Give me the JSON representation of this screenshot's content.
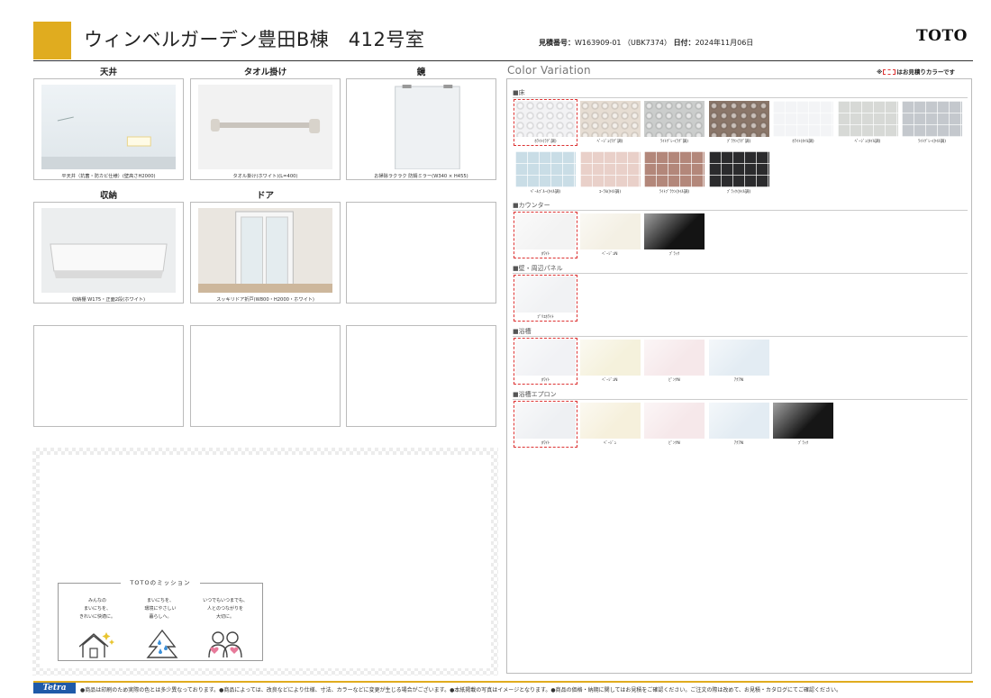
{
  "header": {
    "title": "ウィンベルガーデン豊田B棟　412号室",
    "estimate_label": "見積番号：",
    "estimate_no": "W163909-01 （UBK7374）",
    "date_label": "日付：",
    "date": "2024年11月06日",
    "logo": "TOTO",
    "accent_color": "#e0ac1f"
  },
  "products": [
    {
      "label": "天井",
      "caption": "平天井（抗菌・防カビ仕様）(壁高さH2000)",
      "image": "ceiling-panel-image"
    },
    {
      "label": "タオル掛け",
      "caption": "タオル掛け(ホワイト)(L=400)",
      "image": "towel-bar-image"
    },
    {
      "label": "鏡",
      "caption": "お掃除ラクラク 防錆ミラー(W340 × H455)",
      "image": "mirror-image"
    },
    {
      "label": "収納",
      "caption": "収納棚 W175・正面2段(ホワイト)",
      "image": "shelf-image"
    },
    {
      "label": "ドア",
      "caption": "スッキリドア折戸(W800・H2000・ホワイト)",
      "image": "door-image"
    },
    {
      "label": "",
      "caption": "",
      "image": ""
    },
    {
      "label": "",
      "caption": "",
      "image": ""
    },
    {
      "label": "",
      "caption": "",
      "image": ""
    },
    {
      "label": "",
      "caption": "",
      "image": ""
    }
  ],
  "mission": {
    "title": "TOTOのミッション",
    "columns": [
      {
        "lines": [
          "みんなの",
          "まいにちを、",
          "きれいに快適に。"
        ],
        "icon": "house-sparkle-icon"
      },
      {
        "lines": [
          "まいにちを、",
          "環境にやさしい",
          "暮らしへ。"
        ],
        "icon": "tree-water-icon"
      },
      {
        "lines": [
          "いつでもいつまでも、",
          "人とのつながりを",
          "大切に。"
        ],
        "icon": "people-heart-icon"
      }
    ]
  },
  "color_variation": {
    "title": "Color Variation",
    "note_prefix": "※",
    "note_suffix": "はお見積りカラーです",
    "sections": [
      {
        "name": "■床",
        "swatches": [
          {
            "label": "ﾎﾜｲﾄ(ﾗｸﾞ調)",
            "color": "#f2f2f4",
            "pattern": "tile",
            "selected": true
          },
          {
            "label": "ﾍﾞｰｼﾞｭ(ﾗｸﾞ調)",
            "color": "#e6ddd3",
            "pattern": "tile",
            "selected": false
          },
          {
            "label": "ﾗｲﾄｸﾞﾚｰ(ﾗｸﾞ調)",
            "color": "#cbcdcc",
            "pattern": "tile",
            "selected": false
          },
          {
            "label": "ﾌﾞﾗｳﾝ(ﾗｸﾞ調)",
            "color": "#8a7669",
            "pattern": "tile",
            "selected": false
          },
          {
            "label": "ﾎﾜｲﾄ(ﾀｲﾙ調)",
            "color": "#f3f4f6",
            "pattern": "grid",
            "selected": false
          },
          {
            "label": "ﾍﾞｰｼﾞｭ(ﾀｲﾙ調)",
            "color": "#d7d9d6",
            "pattern": "grid",
            "selected": false
          },
          {
            "label": "ﾗｲﾄｸﾞﾚｰ(ﾀｲﾙ調)",
            "color": "#c4c8cd",
            "pattern": "grid",
            "selected": false
          },
          {
            "label": "ﾍﾟｰﾙﾌﾞﾙｰ(ﾀｲﾙ調)",
            "color": "#c9dde6",
            "pattern": "grid",
            "selected": false
          },
          {
            "label": "ｺｰﾗﾙ(ﾀｲﾙ調)",
            "color": "#e9d0c9",
            "pattern": "grid",
            "selected": false
          },
          {
            "label": "ﾗｲﾄﾌﾞﾗｳﾝ(ﾀｲﾙ調)",
            "color": "#b3877a",
            "pattern": "grid",
            "selected": false
          },
          {
            "label": "ﾌﾞﾗｯｸ(ﾀｲﾙ調)",
            "color": "#2b2b2d",
            "pattern": "grid",
            "selected": false
          }
        ]
      },
      {
        "name": "■カウンター",
        "swatches": [
          {
            "label": "ﾎﾜｲﾄ",
            "color": "#f3f3f3",
            "pattern": "plain",
            "selected": true
          },
          {
            "label": "ﾍﾞｰｼﾞｭN",
            "color": "#f4f0e4",
            "pattern": "plain",
            "selected": false
          },
          {
            "label": "ﾌﾞﾗｯｸ",
            "color": "#141414",
            "pattern": "plain",
            "selected": false
          }
        ]
      },
      {
        "name": "■壁・周辺パネル",
        "swatches": [
          {
            "label": "ﾌﾟﾘｴﾎﾜｲﾄ",
            "color": "#f1f2f4",
            "pattern": "plain",
            "selected": true
          }
        ]
      },
      {
        "name": "■浴槽",
        "swatches": [
          {
            "label": "ﾎﾜｲﾄ",
            "color": "#f1f2f5",
            "pattern": "plain",
            "selected": true
          },
          {
            "label": "ﾍﾞｰｼﾞｭN",
            "color": "#f5f1dc",
            "pattern": "plain",
            "selected": false
          },
          {
            "label": "ﾋﾟﾝｸN",
            "color": "#f6e8ea",
            "pattern": "plain",
            "selected": false
          },
          {
            "label": "ｱｸｱN",
            "color": "#e3ecf3",
            "pattern": "plain",
            "selected": false
          }
        ]
      },
      {
        "name": "■浴槽エプロン",
        "swatches": [
          {
            "label": "ﾎﾜｲﾄ",
            "color": "#eef0f3",
            "pattern": "plain",
            "selected": true
          },
          {
            "label": "ﾍﾞｰｼﾞｭ",
            "color": "#f6f0dc",
            "pattern": "plain",
            "selected": false
          },
          {
            "label": "ﾋﾟﾝｸN",
            "color": "#f6e8ea",
            "pattern": "plain",
            "selected": false
          },
          {
            "label": "ｱｸｱN",
            "color": "#e3ecf3",
            "pattern": "plain",
            "selected": false
          },
          {
            "label": "ﾌﾞﾗｯｸ",
            "color": "#161616",
            "pattern": "plain",
            "selected": false
          }
        ]
      }
    ]
  },
  "footer": {
    "brand": "Tetra",
    "disclaimer": "●商品は印刷のため実際の色とは多少異なっております。●商品によっては、改良などにより仕様、寸法、カラーなどに変更が生じる場合がございます。●本紙掲載の写真はイメージとなります。●商品の価格・納期に関してはお見積をご確認ください。ご注文の際は改めて、お見積・カタログにてご確認ください。"
  }
}
